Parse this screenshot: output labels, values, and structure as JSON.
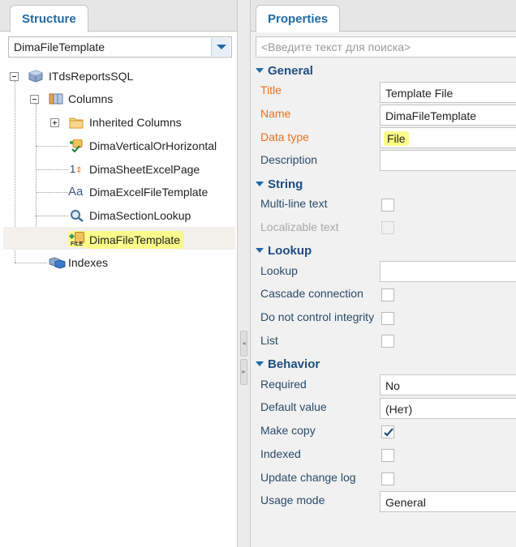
{
  "structure": {
    "tab_label": "Structure",
    "selector_value": "DimaFileTemplate",
    "tree": {
      "root": "ITdsReportsSQL",
      "columns": "Columns",
      "inherited": "Inherited Columns",
      "col1": "DimaVerticalOrHorizontal",
      "col2": "DimaSheetExcelPage",
      "col3": "DimaExcelFileTemplate",
      "col4": "DimaSectionLookup",
      "col5": "DimaFileTemplate",
      "indexes": "Indexes"
    },
    "icon_texts": {
      "integer": "1",
      "text": "Aa",
      "file": "FILE"
    }
  },
  "properties": {
    "tab_label": "Properties",
    "search_placeholder": "<Введите текст для поиска>",
    "general": {
      "header": "General",
      "title_label": "Title",
      "title_value": "Template File",
      "name_label": "Name",
      "name_value": "DimaFileTemplate",
      "datatype_label": "Data type",
      "datatype_value": "File",
      "description_label": "Description",
      "description_value": ""
    },
    "string": {
      "header": "String",
      "multiline_label": "Multi-line text",
      "localizable_label": "Localizable text"
    },
    "lookup": {
      "header": "Lookup",
      "lookup_label": "Lookup",
      "lookup_value": "",
      "cascade_label": "Cascade connection",
      "integrity_label": "Do not control integrity",
      "list_label": "List"
    },
    "behavior": {
      "header": "Behavior",
      "required_label": "Required",
      "required_value": "No",
      "default_label": "Default value",
      "default_value": "(Нет)",
      "makecopy_label": "Make copy",
      "indexed_label": "Indexed",
      "changelog_label": "Update change log",
      "usage_label": "Usage mode",
      "usage_value": "General"
    },
    "checkbox_states": {
      "multiline": false,
      "localizable": false,
      "cascade": false,
      "integrity": false,
      "list": false,
      "makecopy": true,
      "indexed": false,
      "changelog": false
    }
  },
  "colors": {
    "accent": "#1f6aa6",
    "required_label": "#e8731f",
    "highlight": "#fbfb8c"
  }
}
